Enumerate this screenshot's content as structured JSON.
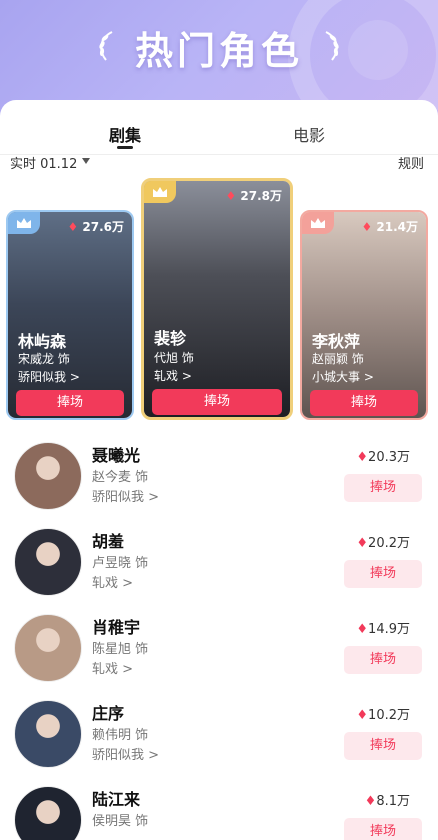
{
  "header": {
    "title": "热门角色"
  },
  "tabs": [
    {
      "label": "剧集"
    },
    {
      "label": "电影"
    }
  ],
  "subbar": {
    "date": "实时 01.12",
    "rules": "规则"
  },
  "featured": [
    {
      "rank": "left",
      "name": "林屿森",
      "actor": "宋威龙 饰",
      "show": "骄阳似我 >",
      "heat": "27.6万",
      "cheer": "捧场"
    },
    {
      "rank": "mid",
      "name": "裴轸",
      "actor": "代旭 饰",
      "show": "轧戏 >",
      "heat": "27.8万",
      "cheer": "捧场"
    },
    {
      "rank": "right",
      "name": "李秋萍",
      "actor": "赵丽颖 饰",
      "show": "小城大事 >",
      "heat": "21.4万",
      "cheer": "捧场"
    }
  ],
  "list": [
    {
      "name": "聂曦光",
      "actor": "赵今麦 饰",
      "show": "骄阳似我 >",
      "heat": "20.3万",
      "cheer": "捧场",
      "avatar_color": "#8c6a5c"
    },
    {
      "name": "胡羞",
      "actor": "卢昱晓 饰",
      "show": "轧戏 >",
      "heat": "20.2万",
      "cheer": "捧场",
      "avatar_color": "#2d2f3a"
    },
    {
      "name": "肖稚宇",
      "actor": "陈星旭 饰",
      "show": "轧戏 >",
      "heat": "14.9万",
      "cheer": "捧场",
      "avatar_color": "#b89a86"
    },
    {
      "name": "庄序",
      "actor": "赖伟明 饰",
      "show": "骄阳似我 >",
      "heat": "10.2万",
      "cheer": "捧场",
      "avatar_color": "#3a4a66"
    },
    {
      "name": "陆江来",
      "actor": "侯明昊 饰",
      "show": "",
      "heat": "8.1万",
      "cheer": "捧场",
      "avatar_color": "#1f2430"
    }
  ],
  "colors": {
    "accent": "#f23a5a",
    "header_gradient_start": "#a8a4f0",
    "header_gradient_end": "#c9b6f2"
  },
  "icons": {
    "flame": "flame-icon",
    "crown": "crown-icon",
    "caret": "caret-down-icon",
    "laurel": "laurel-icon"
  }
}
